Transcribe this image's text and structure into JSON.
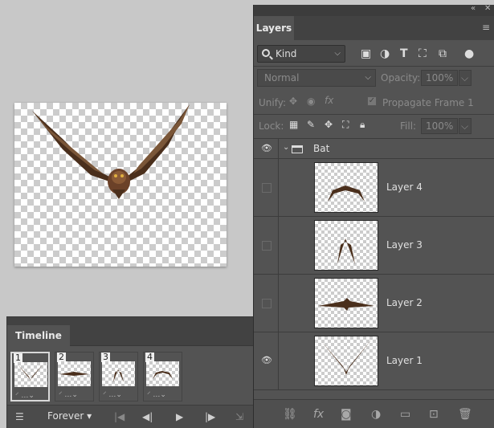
{
  "canvas": {
    "content": "bat-sprite-wings-up"
  },
  "timeline": {
    "tab_label": "Timeline",
    "frames": [
      {
        "number": "1",
        "selected": true
      },
      {
        "number": "2",
        "selected": false
      },
      {
        "number": "3",
        "selected": false
      },
      {
        "number": "4",
        "selected": false
      }
    ],
    "frame_meta": "…",
    "loop_value": "Forever",
    "icons": [
      "convert-icon",
      "first-frame-icon",
      "previous-frame-icon",
      "play-icon",
      "next-frame-icon",
      "tween-icon"
    ]
  },
  "layers": {
    "tab_label": "Layers",
    "filter_kind": "Kind",
    "filter_icons": [
      "image-filter-icon",
      "adjustment-filter-icon",
      "type-filter-icon",
      "shape-filter-icon",
      "smart-object-filter-icon",
      "filter-toggle-icon"
    ],
    "blend_mode": "Normal",
    "opacity_label": "Opacity:",
    "opacity_value": "100%",
    "unify_label": "Unify:",
    "propagate_label": "Propagate Frame 1",
    "lock_label": "Lock:",
    "fill_label": "Fill:",
    "fill_value": "100%",
    "group_name": "Bat",
    "items": [
      {
        "name": "Layer 4",
        "visible": false
      },
      {
        "name": "Layer 3",
        "visible": false
      },
      {
        "name": "Layer 2",
        "visible": false
      },
      {
        "name": "Layer 1",
        "visible": true
      }
    ],
    "bottom_icons": [
      "link-icon",
      "fx-icon",
      "mask-icon",
      "adjustment-icon",
      "folder-icon",
      "new-layer-icon",
      "trash-icon"
    ]
  },
  "colors": {
    "panel": "#535353",
    "panel_dark": "#424242",
    "workspace": "#c8c8c8",
    "bat_brown": "#5a3a22"
  }
}
